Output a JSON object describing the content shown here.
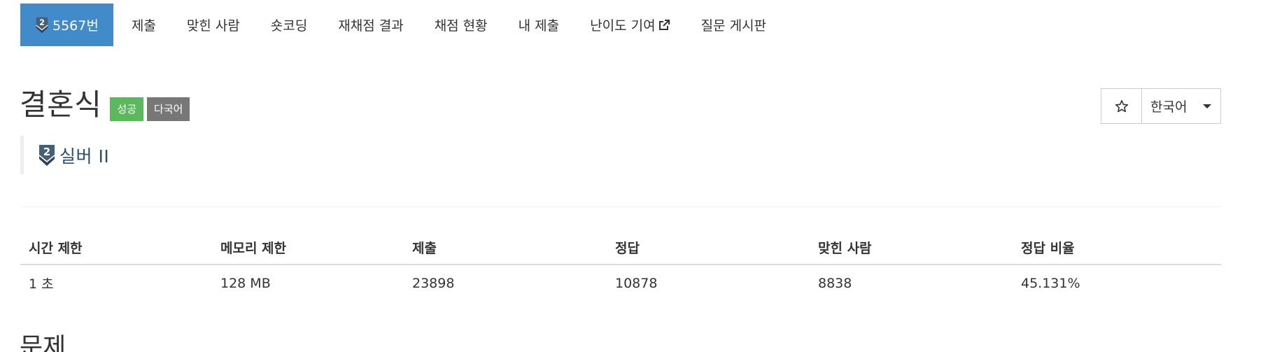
{
  "nav": {
    "problem_tab": "5567번",
    "tabs": [
      "제출",
      "맞힌 사람",
      "숏코딩",
      "재채점 결과",
      "채점 현황",
      "내 제출",
      "난이도 기여",
      "질문 게시판"
    ]
  },
  "problem": {
    "title": "결혼식",
    "badges": [
      "성공",
      "다국어"
    ],
    "tier": {
      "number": "2",
      "name": "실버 II",
      "color": "#435f7a"
    }
  },
  "controls": {
    "star_icon": "star-outline-icon",
    "language": "한국어"
  },
  "info": {
    "headers": [
      "시간 제한",
      "메모리 제한",
      "제출",
      "정답",
      "맞힌 사람",
      "정답 비율"
    ],
    "values": [
      "1 초",
      "128 MB",
      "23898",
      "10878",
      "8838",
      "45.131%"
    ]
  },
  "section": {
    "heading": "문제"
  },
  "colors": {
    "active_tab": "#428bca",
    "badge_success": "#5cb85c",
    "badge_default": "#777777"
  }
}
